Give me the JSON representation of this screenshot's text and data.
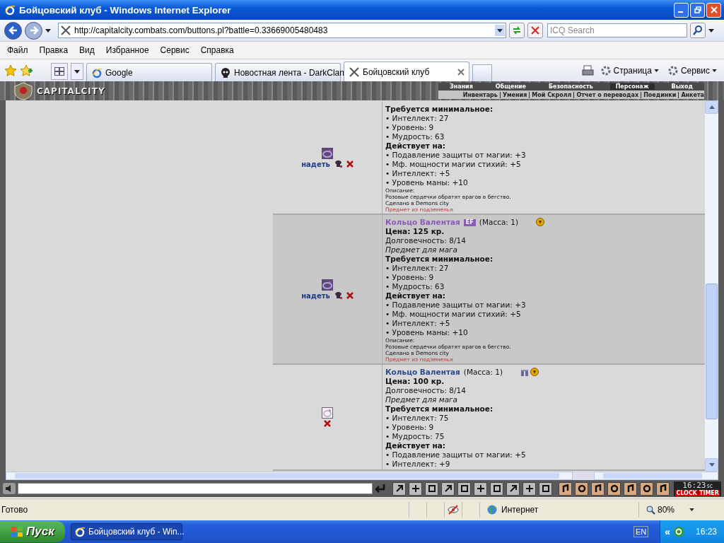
{
  "window": {
    "title": "Бойцовский клуб - Windows Internet Explorer"
  },
  "address": {
    "value": "http://capitalcity.combats.com/buttons.pl?battle=0.33669005480483"
  },
  "search": {
    "placeholder": "ICQ Search"
  },
  "menu": [
    "Файл",
    "Правка",
    "Вид",
    "Избранное",
    "Сервис",
    "Справка"
  ],
  "tabs": [
    {
      "label": "Google",
      "kind": "ie",
      "selected": false
    },
    {
      "label": "Новостная лента - DarkClan",
      "kind": "skull",
      "selected": false
    },
    {
      "label": "Бойцовский клуб",
      "kind": "swords",
      "selected": true
    }
  ],
  "command_bar": [
    "Страница",
    "Сервис"
  ],
  "game_header": {
    "logo": "CAPITALCITY",
    "nav": [
      {
        "label": "Знания",
        "selected": false
      },
      {
        "label": "Общение",
        "selected": false
      },
      {
        "label": "Безопасность",
        "selected": false
      },
      {
        "label": "Персонаж",
        "selected": true
      },
      {
        "label": "Выход",
        "selected": false
      }
    ],
    "subnav": [
      "Инвентарь",
      "Умения",
      "Мой Скролл",
      "Отчет о переводах",
      "Поединки",
      "Анкета"
    ]
  },
  "items": [
    {
      "kind": "dark",
      "highlighted": false,
      "wear_link": "надеть",
      "req_heading": "Требуется минимальное:",
      "requirements": [
        "• Интеллект: 27",
        "• Уровень: 9",
        "• Мудрость: 63"
      ],
      "effects_heading": "Действует на:",
      "effects": [
        "• Подавление защиты от магии: +3",
        "• Мф. мощности магии стихий: +5",
        "• Интеллект: +5",
        "• Уровень маны: +10"
      ],
      "desc_label": "Описание:",
      "description": "Розовые сердечки обратят врагов в бегство.",
      "made_in": "Сделано в Demons city",
      "dungeon_note": "Предмет из подземелья"
    },
    {
      "kind": "dark",
      "highlighted": true,
      "gift": false,
      "wear_link": "надеть",
      "title": {
        "name": "Кольцо Валентая",
        "color": "#8a5cb4",
        "badge": "EF",
        "mass": "(Масса: 1)"
      },
      "price": "Цена: 125 кр.",
      "durability": "Долговечность: 8/14",
      "class_note": "Предмет для мага",
      "req_heading": "Требуется минимальное:",
      "requirements": [
        "• Интеллект: 27",
        "• Уровень: 9",
        "• Мудрость: 63"
      ],
      "effects_heading": "Действует на:",
      "effects": [
        "• Подавление защиты от магии: +3",
        "• Мф. мощности магии стихий: +5",
        "• Интеллект: +5",
        "• Уровень маны: +10"
      ],
      "desc_label": "Описание:",
      "description": "Розовые сердечки обратят врагов в бегство.",
      "made_in": "Сделано в Demons city",
      "dungeon_note": "Предмет из подземелья"
    },
    {
      "kind": "pale",
      "highlighted": false,
      "gift": true,
      "title": {
        "name": "Кольцо Валентая",
        "color": "#2c4a8c",
        "mass": "(Масса: 1)"
      },
      "price": "Цена: 100 кр.",
      "durability": "Долговечность: 8/14",
      "class_note": "Предмет для мага",
      "req_heading": "Требуется минимальное:",
      "requirements": [
        "• Интеллект: 75",
        "• Уровень: 9",
        "• Мудрость: 75"
      ],
      "effects_heading": "Действует на:",
      "effects": [
        "• Подавление защиты от магии: +5",
        "• Интеллект: +9"
      ]
    }
  ],
  "clock": {
    "time": "16:23",
    "unit": "sc",
    "labels": [
      "CLOCK",
      "TIMER"
    ]
  },
  "status_bar": {
    "text": "Готово",
    "zone": "Интернет",
    "zoom": "80%"
  },
  "taskbar": {
    "start": "Пуск",
    "task": "Бойцовский клуб - Win...",
    "language": "EN",
    "chevron": "«",
    "time": "16:23"
  }
}
